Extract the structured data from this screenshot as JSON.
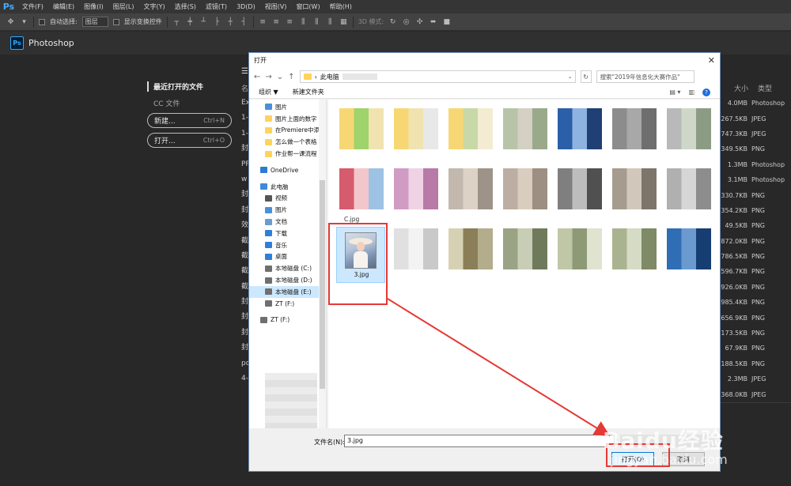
{
  "menubar": {
    "logo": "Ps",
    "items": [
      "文件(F)",
      "编辑(E)",
      "图像(I)",
      "图层(L)",
      "文字(Y)",
      "选择(S)",
      "滤镜(T)",
      "3D(D)",
      "视图(V)",
      "窗口(W)",
      "帮助(H)"
    ]
  },
  "options": {
    "auto_select": "自动选择:",
    "layer_select": "图层",
    "show_transform": "显示变换控件",
    "mode_3d": "3D 模式:"
  },
  "start": {
    "app_name": "Photoshop",
    "recent": "最近打开的文件",
    "cc_files": "CC 文件",
    "new_label": "新建...",
    "new_shortcut": "Ctrl+N",
    "open_label": "打开...",
    "open_shortcut": "Ctrl+O",
    "header_name": "名",
    "header_size": "大小",
    "header_type": "类型"
  },
  "file_list": {
    "names": [
      "Ex",
      "1-",
      "1-",
      "封",
      "PR",
      "w",
      "封",
      "封",
      "效",
      "截",
      "截",
      "截",
      "截",
      "封",
      "封",
      "封",
      "封",
      "po",
      "4-"
    ],
    "rows": [
      {
        "size": "4.0MB",
        "type": "Photoshop"
      },
      {
        "size": "267.5KB",
        "type": "JPEG"
      },
      {
        "size": "747.3KB",
        "type": "JPEG"
      },
      {
        "size": "349.5KB",
        "type": "PNG"
      },
      {
        "size": "1.3MB",
        "type": "Photoshop"
      },
      {
        "size": "3.1MB",
        "type": "Photoshop"
      },
      {
        "size": "330.7KB",
        "type": "PNG"
      },
      {
        "size": "354.2KB",
        "type": "PNG"
      },
      {
        "size": "49.5KB",
        "type": "PNG"
      },
      {
        "size": "872.0KB",
        "type": "PNG"
      },
      {
        "size": "786.5KB",
        "type": "PNG"
      },
      {
        "size": "596.7KB",
        "type": "PNG"
      },
      {
        "size": "926.0KB",
        "type": "PNG"
      },
      {
        "size": "985.4KB",
        "type": "PNG"
      },
      {
        "size": "656.9KB",
        "type": "PNG"
      },
      {
        "size": "173.5KB",
        "type": "PNG"
      },
      {
        "size": "67.9KB",
        "type": "PNG"
      },
      {
        "size": "188.5KB",
        "type": "PNG"
      },
      {
        "size": "2.3MB",
        "type": "JPEG"
      },
      {
        "size": "368.0KB",
        "type": "JPEG"
      }
    ]
  },
  "dialog": {
    "title": "打开",
    "address": "此电脑",
    "search_placeholder": "搜索\"2019年信息化大赛作品\"",
    "organize": "组织 ▼",
    "new_folder": "新建文件夹",
    "nav": [
      {
        "label": "图片",
        "color": "#4a90d9",
        "kind": "sub",
        "selected": false
      },
      {
        "label": "图片上面的数字",
        "color": "#ffd35c",
        "kind": "sub",
        "selected": false
      },
      {
        "label": "在Premiere中添",
        "color": "#ffd35c",
        "kind": "sub",
        "selected": false
      },
      {
        "label": "怎么做一个表格",
        "color": "#ffd35c",
        "kind": "sub",
        "selected": false
      },
      {
        "label": "作业帮一课流程",
        "color": "#ffd35c",
        "kind": "sub",
        "selected": false
      },
      {
        "label": "",
        "color": "",
        "kind": "gap",
        "selected": false
      },
      {
        "label": "OneDrive",
        "color": "#2b7cd3",
        "kind": "root",
        "selected": false
      },
      {
        "label": "",
        "color": "",
        "kind": "gap",
        "selected": false
      },
      {
        "label": "此电脑",
        "color": "#3d8bd9",
        "kind": "root",
        "selected": false
      },
      {
        "label": "视频",
        "color": "#555555",
        "kind": "sub",
        "selected": false
      },
      {
        "label": "图片",
        "color": "#4a90d9",
        "kind": "sub",
        "selected": false
      },
      {
        "label": "文档",
        "color": "#6b9bd1",
        "kind": "sub",
        "selected": false
      },
      {
        "label": "下载",
        "color": "#2f7fd8",
        "kind": "sub",
        "selected": false
      },
      {
        "label": "音乐",
        "color": "#2f7fd8",
        "kind": "sub",
        "selected": false
      },
      {
        "label": "桌面",
        "color": "#2f7fd8",
        "kind": "sub",
        "selected": false
      },
      {
        "label": "本地磁盘 (C:)",
        "color": "#6f6f6f",
        "kind": "sub",
        "selected": false
      },
      {
        "label": "本地磁盘 (D:)",
        "color": "#6f6f6f",
        "kind": "sub",
        "selected": false
      },
      {
        "label": "本地磁盘 (E:)",
        "color": "#6f6f6f",
        "kind": "sub",
        "selected": true
      },
      {
        "label": "ZT (F:)",
        "color": "#6f6f6f",
        "kind": "sub",
        "selected": false
      },
      {
        "label": "",
        "color": "",
        "kind": "gap",
        "selected": false
      },
      {
        "label": "ZT (F:)",
        "color": "#6f6f6f",
        "kind": "root",
        "selected": false
      }
    ],
    "partial_label": "C.jpg",
    "selected_file_label": "3.jpg",
    "filename_label": "文件名(N):",
    "filename_value": "3.jpg",
    "open_button": "打开(O)",
    "cancel_button": "取消"
  },
  "watermark": {
    "brand": "Baidu经验",
    "url": "jingyan.baidu.com"
  },
  "colors": {
    "ps_blue": "#31a8ff",
    "highlight_red": "#e53935",
    "selection_blue": "#cce8ff"
  }
}
